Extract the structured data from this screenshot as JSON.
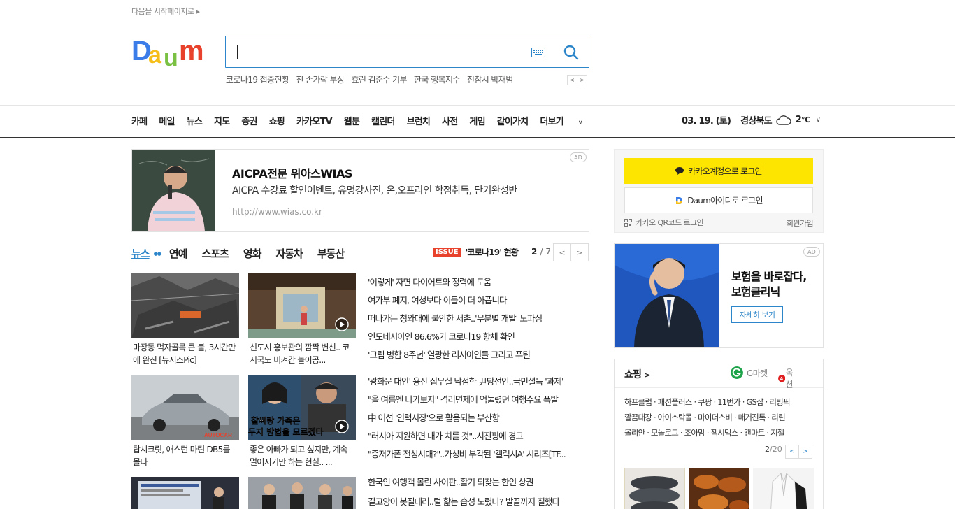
{
  "header": {
    "startpage": "다음을 시작페이지로",
    "logo_text": "Daum"
  },
  "search": {
    "value": "",
    "placeholder": ""
  },
  "trends": [
    "코로나19 접종현황",
    "진 손가락 부상",
    "효린 김준수 기부",
    "한국 행복지수",
    "전참시 박재범"
  ],
  "gnb": [
    "카페",
    "메일",
    "뉴스",
    "지도",
    "증권",
    "쇼핑",
    "카카오TV",
    "웹툰",
    "캘린더",
    "브런치",
    "사전",
    "게임",
    "같이가치",
    "더보기"
  ],
  "weather": {
    "date": "03. 19. (토)",
    "region": "경상북도",
    "temp": "2",
    "unit": "℃"
  },
  "ad_top": {
    "badge": "AD",
    "title": "AICPA전문 위아스WIAS",
    "desc": "AICPA 수강료 할인이벤트, 유명강사진, 온,오프라인 학점취득, 단기완성반",
    "url": "http://www.wias.co.kr"
  },
  "news_tabs": [
    "뉴스",
    "연예",
    "스포츠",
    "영화",
    "자동차",
    "부동산"
  ],
  "issue": {
    "badge": "ISSUE",
    "title": "'코로나19' 현황",
    "page": "2",
    "total": "/ 7"
  },
  "thumbs": [
    {
      "caption": "마장동 먹자골목 큰 불, 3시간만에 완진 [뉴시스Pic]"
    },
    {
      "caption": "신도시 홍보관의 깜짝 변신.. 코시국도 비켜간 놀이공..."
    },
    {
      "caption": "탑시크릿, 애스턴 마틴 DB5를 몰다"
    },
    {
      "caption": "좋은 아빠가 되고 싶지만, 계속 멀어지기만 하는 현실.. ..."
    }
  ],
  "headlines_1": [
    "'이렇게' 자면 다이어트와 정력에 도움",
    "여가부 폐지, 여성보다 이들이 더 아픕니다",
    "떠나가는 청와대에 불안한 서촌..'무분별 개발' 노파심",
    "인도네시아인 86.6%가 코로나19 항체 확인",
    "'크림 병합 8주년' 열광한 러시아인들 그리고 푸틴"
  ],
  "headlines_2": [
    "'광화문 대안' 용산 집무실 낙점한 尹당선인..국민설득 '과제'",
    "\"올 여름엔 나가보자\" 격리면제에 억눌렸던 여행수요 폭발",
    "中 어선 '인력시장'으로 활용되는 부산항",
    "\"러시아 지원하면 대가 치를 것\"..시진핑에 경고",
    "\"중저가폰 전성시대?\"..가성비 부각된 '갤럭시A' 시리즈[TF..."
  ],
  "headlines_3": [
    "한국인 여행객 몰린 사이판..활기 되찾는 한인 상권",
    "길고양이 봇질테러..털 핥는 습성 노렸나? 발끝까지 칠했다"
  ],
  "thumb_labels": {
    "autocar": "AUTOCAR",
    "tv_line1": "찰씨랑 가족은",
    "tv_line2": "두지 방법을 모르겠다"
  },
  "login": {
    "kakao": "카카오계정으로 로그인",
    "daum": "Daum아이디로 로그인",
    "qr": "카카오 QR코드 로그인",
    "signup": "회원가입"
  },
  "ad_side": {
    "badge": "AD",
    "title": "보험을 바로잡다, 보험클리닉",
    "button": "자세히 보기"
  },
  "shopping": {
    "title": "쇼핑",
    "gmarket": "G마켓",
    "auction": "옥션",
    "links": [
      "하프클럽 · 패션플러스 · 쿠팡 · 11번가 · GS샵 · 리빙픽",
      "깔끔대장 · 아이스탁몰 · 마이더스비 · 매거진톡 · 리린",
      "몰리안 · 모놀로그 · 조아맘 · 젝시믹스 · 캔마트 · 지젤"
    ],
    "page": "2",
    "total": "/20"
  },
  "colors": {
    "accent": "#2d86c9",
    "kakao": "#fee500",
    "issue": "#e8412c"
  }
}
